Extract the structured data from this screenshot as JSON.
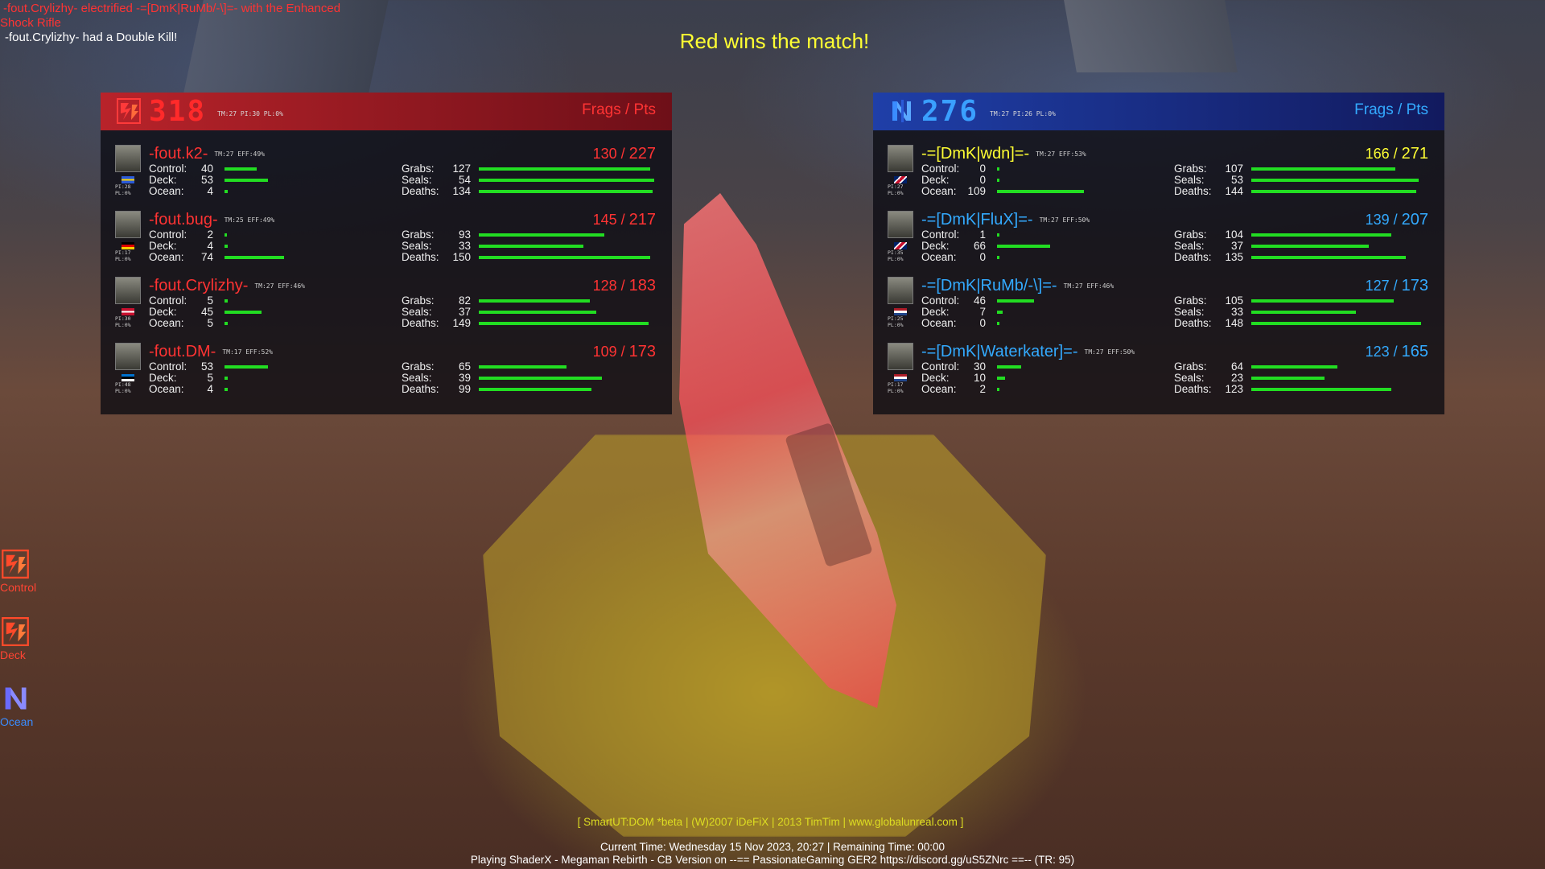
{
  "kill_log": {
    "line1": "-fout.Crylizhy- electrified -=[DmK|RuMb/-\\]=- with the Enhanced",
    "line2": "Shock Rifle",
    "line3": "-fout.Crylizhy- had a Double Kill!"
  },
  "win_message": "Red wins the match!",
  "teams": {
    "red": {
      "score": "318",
      "stats": "TM:27 PI:30 PL:0%",
      "frags_pts_label": "Frags / Pts",
      "players": [
        {
          "name": "-fout.k2-",
          "meta": "TM:27 EFF:49%",
          "pi": "PI:28",
          "pl": "PL:0%",
          "frags": "130",
          "pts": "227",
          "control": "40",
          "deck": "53",
          "ocean": "4",
          "grabs": "127",
          "seals": "54",
          "deaths": "134",
          "bars": {
            "control": 0.2,
            "deck": 0.27,
            "ocean": 0.02,
            "grabs": 0.82,
            "seals": 0.84,
            "deaths": 0.83
          }
        },
        {
          "name": "-fout.bug-",
          "meta": "TM:25 EFF:49%",
          "pi": "PI:17",
          "pl": "PL:0%",
          "frags": "145",
          "pts": "217",
          "control": "2",
          "deck": "4",
          "ocean": "74",
          "grabs": "93",
          "seals": "33",
          "deaths": "150",
          "bars": {
            "control": 0.01,
            "deck": 0.02,
            "ocean": 0.37,
            "grabs": 0.6,
            "seals": 0.5,
            "deaths": 0.82
          }
        },
        {
          "name": "-fout.Crylizhy-",
          "meta": "TM:27 EFF:46%",
          "pi": "PI:30",
          "pl": "PL:0%",
          "frags": "128",
          "pts": "183",
          "control": "5",
          "deck": "45",
          "ocean": "5",
          "grabs": "82",
          "seals": "37",
          "deaths": "149",
          "bars": {
            "control": 0.02,
            "deck": 0.23,
            "ocean": 0.02,
            "grabs": 0.53,
            "seals": 0.56,
            "deaths": 0.81
          }
        },
        {
          "name": "-fout.DM-",
          "meta": "TM:17 EFF:52%",
          "pi": "PI:48",
          "pl": "PL:0%",
          "frags": "109",
          "pts": "173",
          "control": "53",
          "deck": "5",
          "ocean": "4",
          "grabs": "65",
          "seals": "39",
          "deaths": "99",
          "bars": {
            "control": 0.27,
            "deck": 0.02,
            "ocean": 0.02,
            "grabs": 0.42,
            "seals": 0.59,
            "deaths": 0.54
          }
        }
      ]
    },
    "blue": {
      "score": "276",
      "stats": "TM:27 PI:26 PL:0%",
      "frags_pts_label": "Frags / Pts",
      "players": [
        {
          "name": "-=[DmK|wdn]=-",
          "meta": "TM:27 EFF:53%",
          "pi": "PI:27",
          "pl": "PL:0%",
          "frags": "166",
          "pts": "271",
          "control": "0",
          "deck": "0",
          "ocean": "109",
          "grabs": "107",
          "seals": "53",
          "deaths": "144",
          "top": true,
          "bars": {
            "control": 0,
            "deck": 0,
            "ocean": 0.54,
            "grabs": 0.69,
            "seals": 0.8,
            "deaths": 0.79
          }
        },
        {
          "name": "-=[DmK|FluX]=-",
          "meta": "TM:27 EFF:50%",
          "pi": "PI:35",
          "pl": "PL:0%",
          "frags": "139",
          "pts": "207",
          "control": "1",
          "deck": "66",
          "ocean": "0",
          "grabs": "104",
          "seals": "37",
          "deaths": "135",
          "bars": {
            "control": 0.005,
            "deck": 0.33,
            "ocean": 0,
            "grabs": 0.67,
            "seals": 0.56,
            "deaths": 0.74
          }
        },
        {
          "name": "-=[DmK|RuMb/-\\]=-",
          "meta": "TM:27 EFF:46%",
          "pi": "PI:25",
          "pl": "PL:0%",
          "frags": "127",
          "pts": "173",
          "control": "46",
          "deck": "7",
          "ocean": "0",
          "grabs": "105",
          "seals": "33",
          "deaths": "148",
          "bars": {
            "control": 0.23,
            "deck": 0.035,
            "ocean": 0,
            "grabs": 0.68,
            "seals": 0.5,
            "deaths": 0.81
          }
        },
        {
          "name": "-=[DmK|Waterkater]=-",
          "meta": "TM:27 EFF:50%",
          "pi": "PI:17",
          "pl": "PL:0%",
          "frags": "123",
          "pts": "165",
          "control": "30",
          "deck": "10",
          "ocean": "2",
          "grabs": "64",
          "seals": "23",
          "deaths": "123",
          "bars": {
            "control": 0.15,
            "deck": 0.05,
            "ocean": 0.01,
            "grabs": 0.41,
            "seals": 0.35,
            "deaths": 0.67
          }
        }
      ]
    }
  },
  "labels": {
    "control": "Control:",
    "deck": "Deck:",
    "ocean": "Ocean:",
    "grabs": "Grabs:",
    "seals": "Seals:",
    "deaths": "Deaths:"
  },
  "control_points": [
    {
      "name": "Control",
      "team": "red"
    },
    {
      "name": "Deck",
      "team": "red"
    },
    {
      "name": "Ocean",
      "team": "blue"
    }
  ],
  "footer": {
    "credits": "[ SmartUT:DOM  *beta | (W)2007 iDeFiX | 2013 TimTim | www.globalunreal.com ]",
    "time": "Current Time: Wednesday 15 Nov 2023, 20:27 | Remaining Time: 00:00",
    "server": "Playing ShaderX - Megaman Rebirth - CB Version on --== PassionateGaming GER2 https://discord.gg/uS5ZNrc ==-- (TR: 95)"
  },
  "colors": {
    "red_team": "#ff3333",
    "blue_team": "#33aaff",
    "highlight": "#ffff33",
    "bar": "#22dd22"
  }
}
